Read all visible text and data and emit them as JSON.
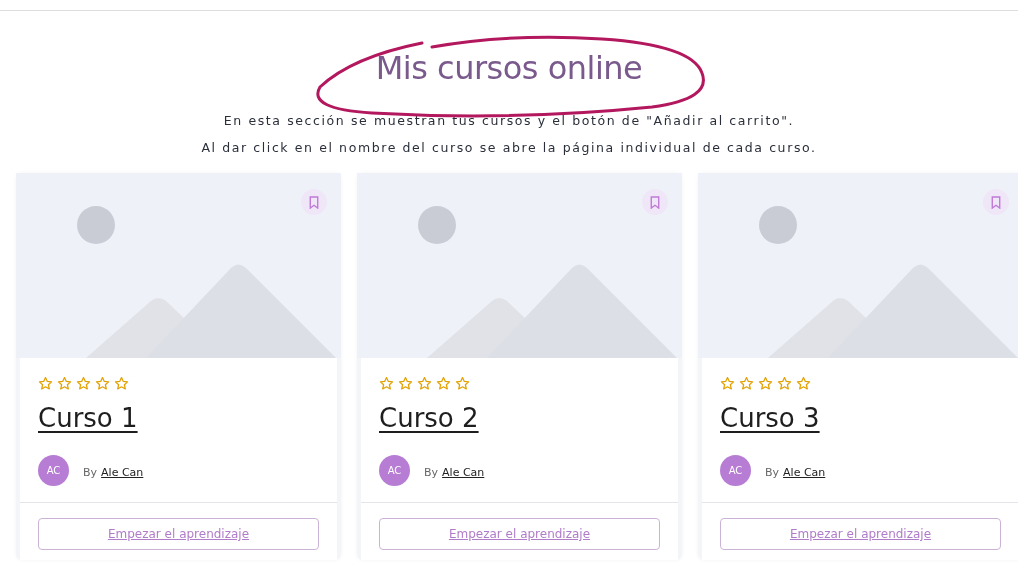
{
  "header": {
    "title": "Mis cursos online",
    "description": [
      "En esta sección se muestran tus cursos y el botón de \"Añadir al carrito\".",
      "Al dar click en el nombre del curso se abre la página individual de cada curso."
    ]
  },
  "courses": [
    {
      "stars": 0,
      "title": "Curso 1",
      "avatar": "AC",
      "by_label": "By",
      "author": "Ale Can",
      "button": "Empezar el aprendizaje"
    },
    {
      "stars": 0,
      "title": "Curso 2",
      "avatar": "AC",
      "by_label": "By",
      "author": "Ale Can",
      "button": "Empezar el aprendizaje"
    },
    {
      "stars": 0,
      "title": "Curso 3",
      "avatar": "AC",
      "by_label": "By",
      "author": "Ale Can",
      "button": "Empezar el aprendizaje"
    }
  ]
}
